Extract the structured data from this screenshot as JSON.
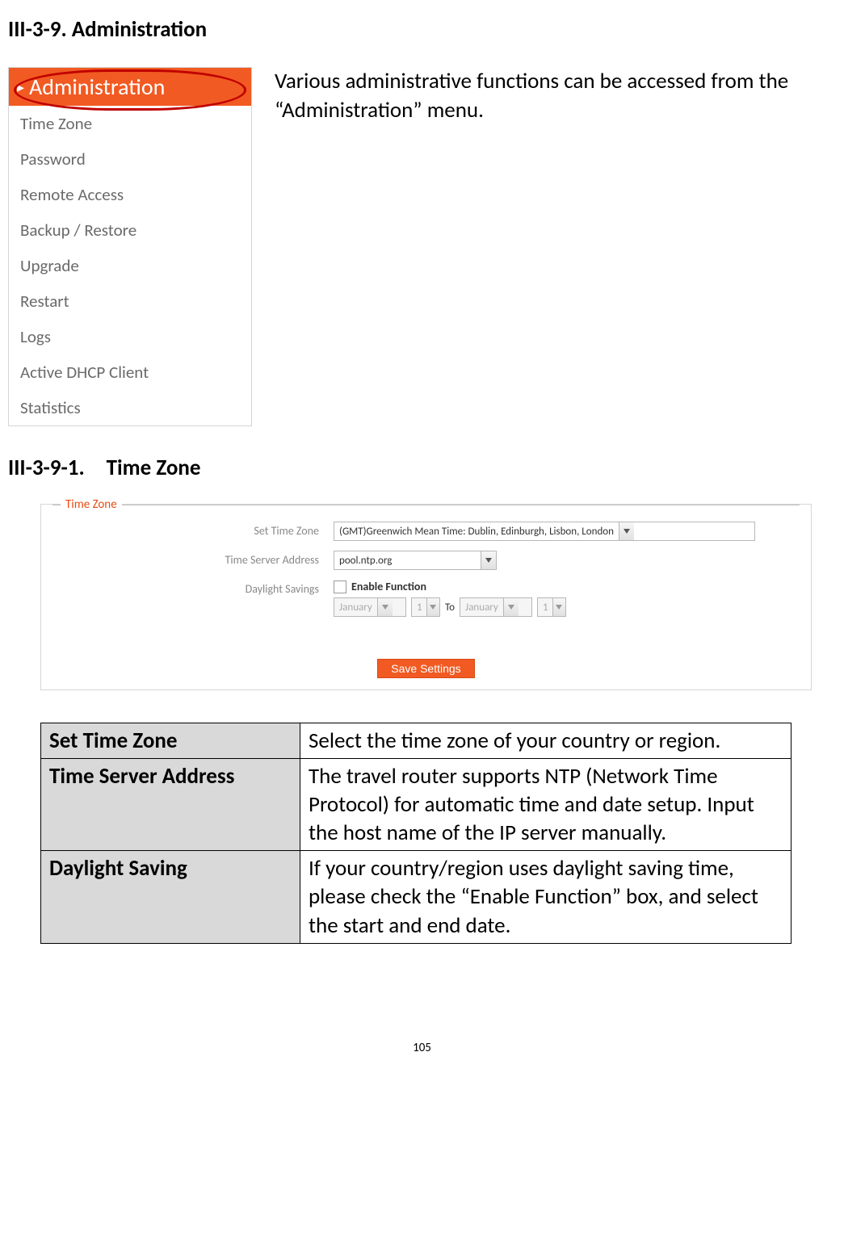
{
  "headings": {
    "main": "III-3-9. Administration",
    "sub": "III-3-9-1. Time Zone"
  },
  "intro_text": "Various administrative functions can be accessed from the “Administration” menu.",
  "admin_menu": {
    "header": "Administration",
    "items": [
      "Time Zone",
      "Password",
      "Remote Access",
      "Backup / Restore",
      "Upgrade",
      "Restart",
      "Logs",
      "Active DHCP Client",
      "Statistics"
    ]
  },
  "time_zone_panel": {
    "legend": "Time Zone",
    "labels": {
      "set_tz": "Set Time Zone",
      "ts_addr": "Time Server Address",
      "daylight": "Daylight Savings"
    },
    "values": {
      "tz_selected": "(GMT)Greenwich Mean Time: Dublin, Edinburgh, Lisbon, London",
      "ts_value": "pool.ntp.org",
      "enable_label": "Enable Function",
      "from_month": "January",
      "from_day": "1",
      "to_word": "To",
      "to_month": "January",
      "to_day": "1"
    },
    "save_label": "Save Settings"
  },
  "desc_table": {
    "rows": [
      {
        "key": "Set Time Zone",
        "value": "Select the time zone of your country or region."
      },
      {
        "key": "Time Server Address",
        "value": "The travel router supports NTP (Network Time Protocol) for automatic time and date setup. Input the host name of the IP server manually."
      },
      {
        "key": "Daylight Saving",
        "value": "If your country/region uses daylight saving time, please check the “Enable Function” box, and select the start and end date."
      }
    ]
  },
  "page_number": "105"
}
